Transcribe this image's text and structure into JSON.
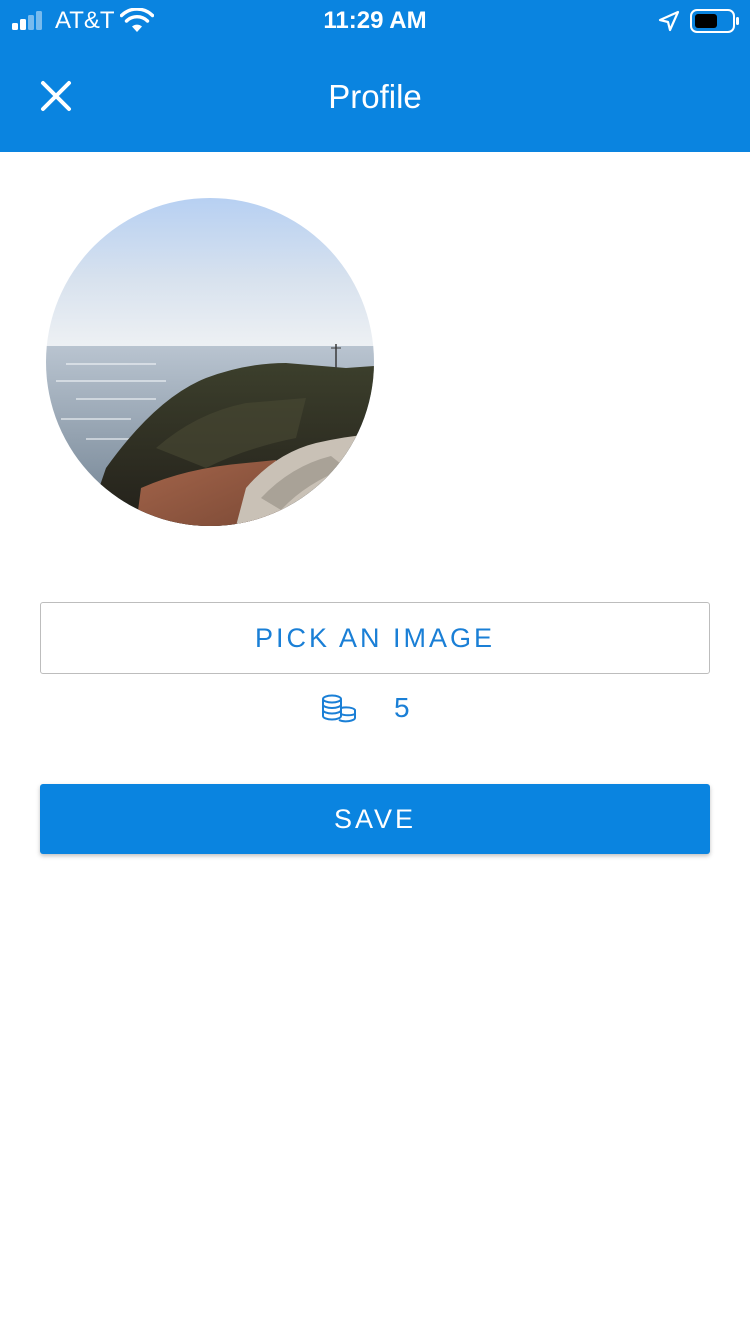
{
  "status_bar": {
    "carrier": "AT&T",
    "time": "11:29 AM",
    "icons": [
      "signal-icon",
      "wifi-icon",
      "location-arrow-icon",
      "battery-icon"
    ]
  },
  "header": {
    "title": "Profile",
    "close_icon": "close-icon"
  },
  "profile": {
    "avatar_description": "profile-photo",
    "pick_image_label": "PICK AN IMAGE",
    "coins_icon": "coins-icon",
    "coins_count": "5",
    "save_label": "SAVE"
  },
  "colors": {
    "primary": "#0a84e0",
    "accent_text": "#1a7fd6",
    "background": "#ffffff",
    "border": "#bdbdbd"
  }
}
